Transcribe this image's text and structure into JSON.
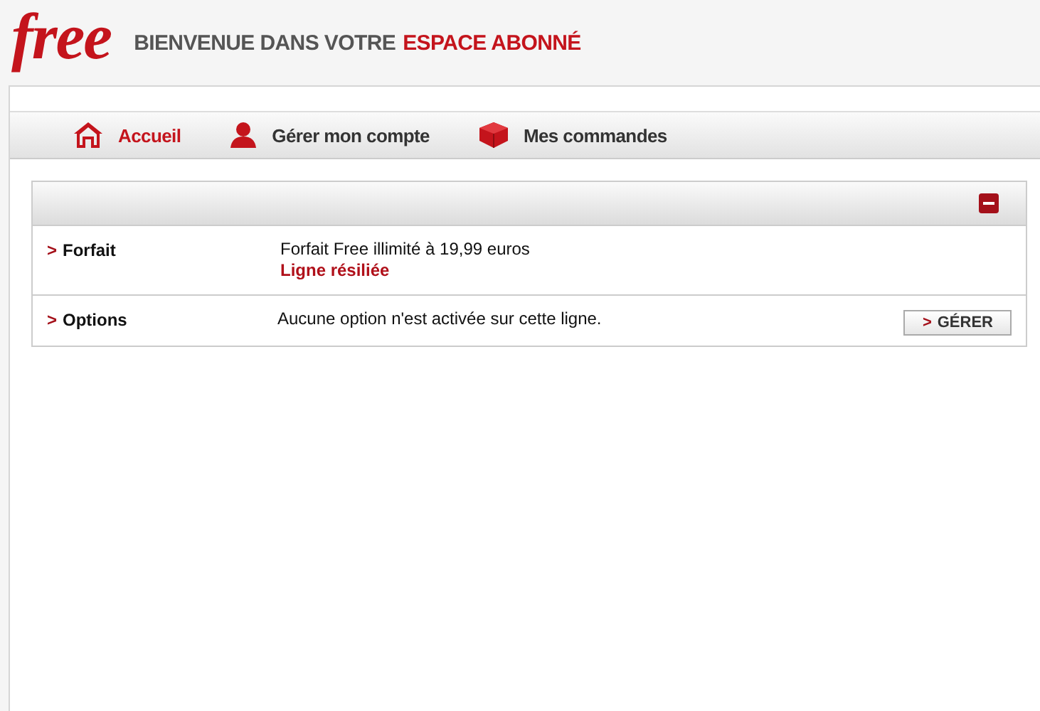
{
  "header": {
    "logo": "free",
    "title": "BIENVENUE DANS VOTRE",
    "title_highlight": "ESPACE ABONNÉ"
  },
  "nav": [
    {
      "kind": "home",
      "label": "Accueil",
      "selected": true
    },
    {
      "kind": "person",
      "label": "Gérer mon compte",
      "selected": false
    },
    {
      "kind": "box",
      "label": "Mes commandes",
      "selected": false
    }
  ],
  "panel": {
    "expanded": true,
    "rows": [
      {
        "marker": ">",
        "label": "Forfait",
        "value": "Forfait Free illimité à 19,99 euros",
        "status": "Ligne résiliée"
      },
      {
        "marker": ">",
        "label": "Options",
        "value": "Aucune option n'est activée sur cette ligne.",
        "button": {
          "marker": ">",
          "label": "GÉRER"
        }
      }
    ]
  }
}
